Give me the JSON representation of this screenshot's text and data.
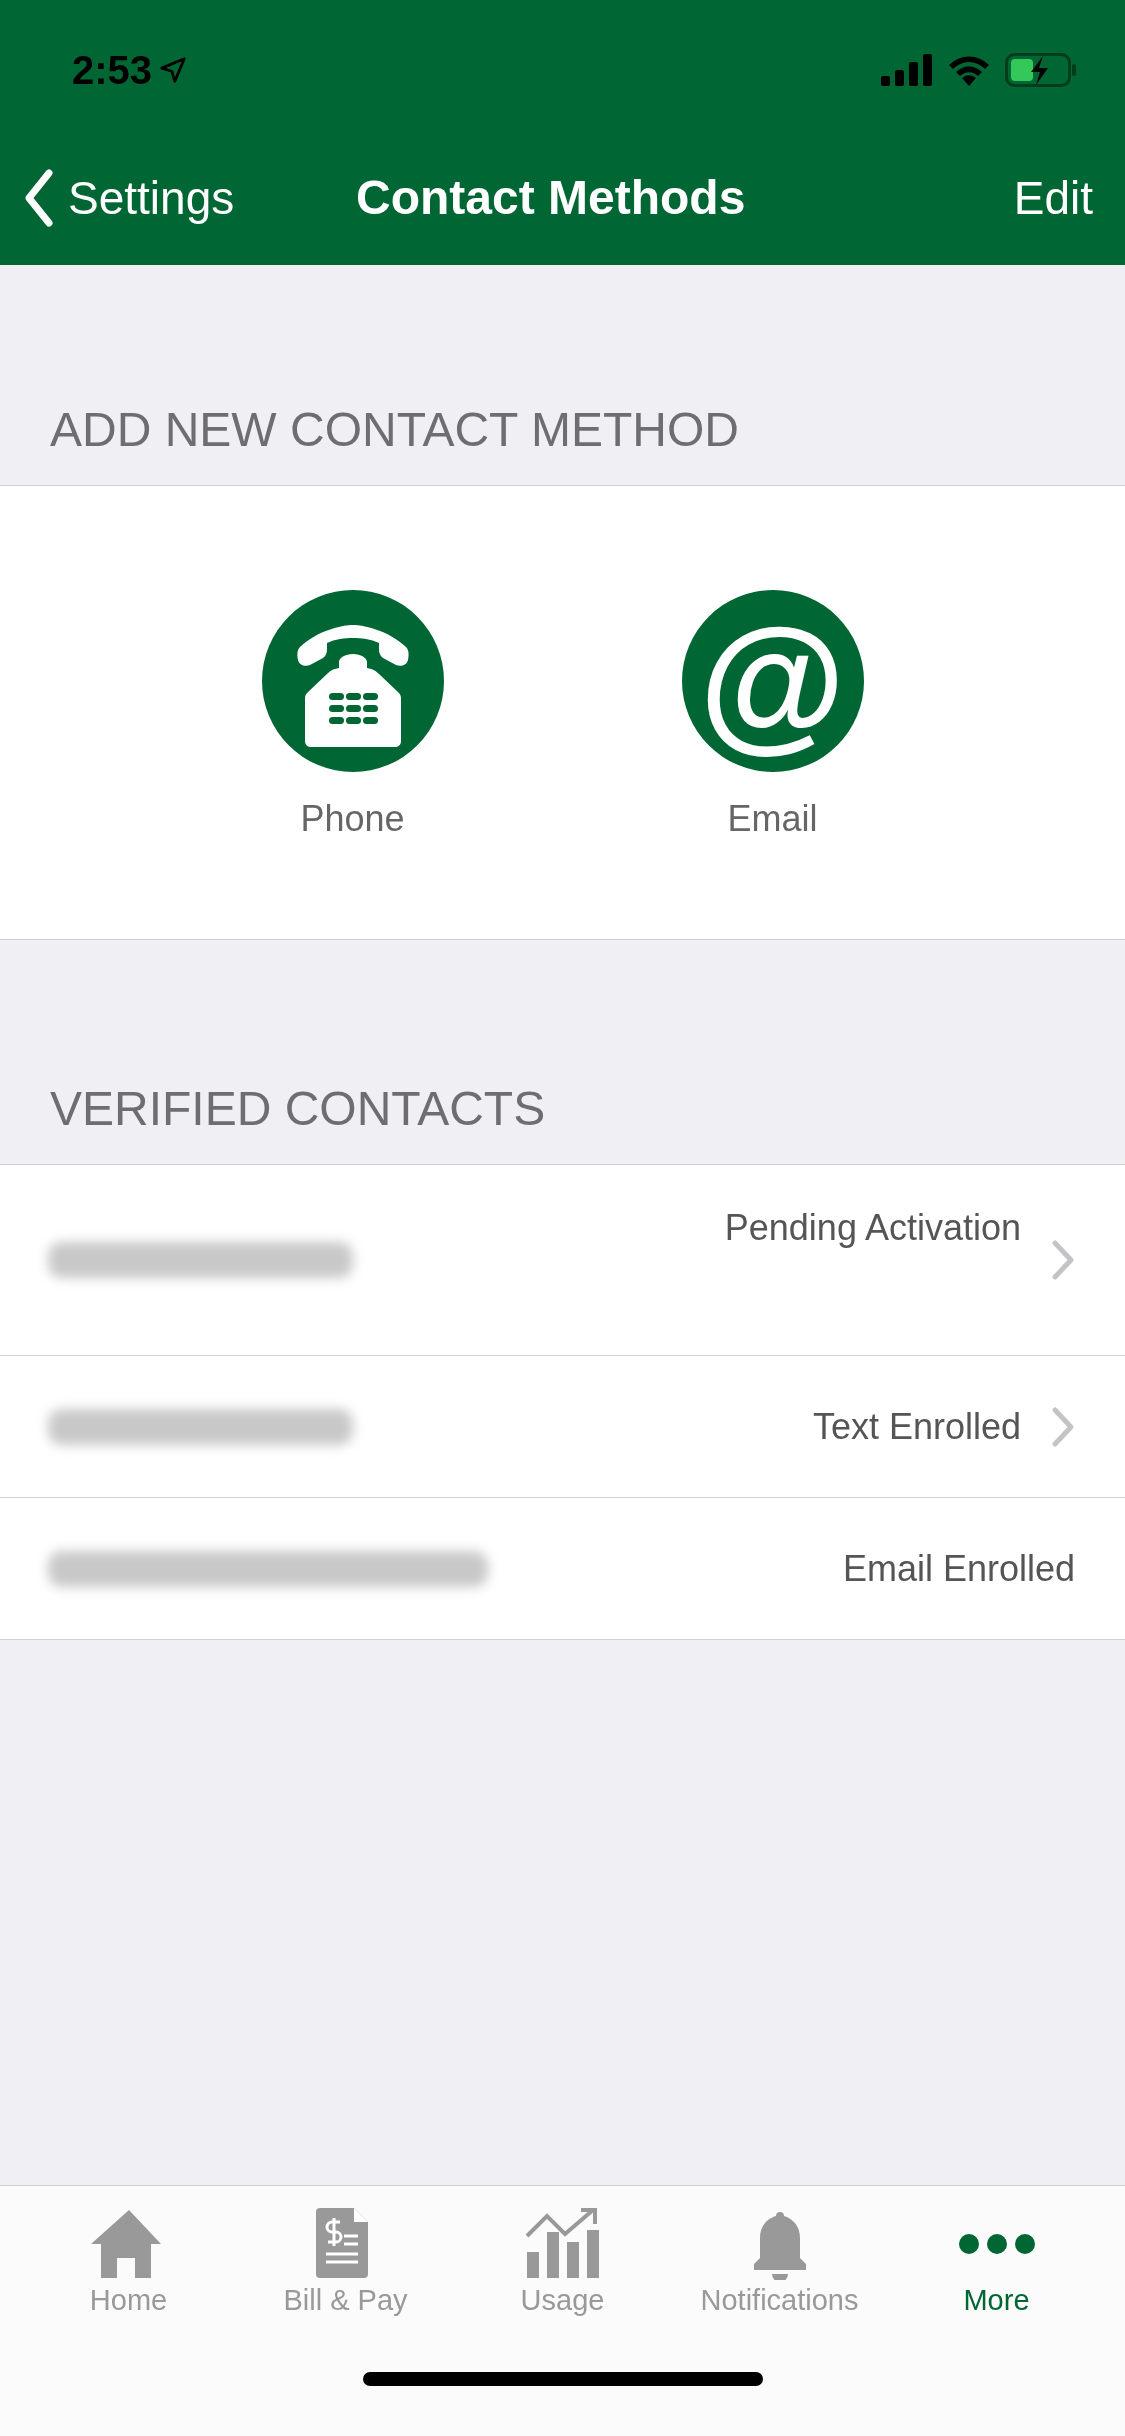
{
  "status_bar": {
    "time": "2:53"
  },
  "nav": {
    "back": "Settings",
    "title": "Contact Methods",
    "action": "Edit"
  },
  "add_section": {
    "header": "ADD NEW CONTACT METHOD",
    "methods": [
      {
        "kind": "phone",
        "label": "Phone"
      },
      {
        "kind": "email",
        "label": "Email",
        "glyph": "@"
      }
    ]
  },
  "verified_section": {
    "header": "VERIFIED CONTACTS",
    "rows": [
      {
        "kind": "phone",
        "status": "Pending Activation",
        "chevron": true,
        "tall": true
      },
      {
        "kind": "phone",
        "status": "Text Enrolled",
        "chevron": true,
        "tall": false
      },
      {
        "kind": "email",
        "status": "Email Enrolled",
        "chevron": false,
        "tall": false
      }
    ]
  },
  "tab_bar": [
    {
      "kind": "home",
      "label": "Home",
      "selected": false
    },
    {
      "kind": "bill",
      "label": "Bill & Pay",
      "selected": false
    },
    {
      "kind": "usage",
      "label": "Usage",
      "selected": false
    },
    {
      "kind": "bell",
      "label": "Notifications",
      "selected": false
    },
    {
      "kind": "more",
      "label": "More",
      "selected": true
    }
  ]
}
